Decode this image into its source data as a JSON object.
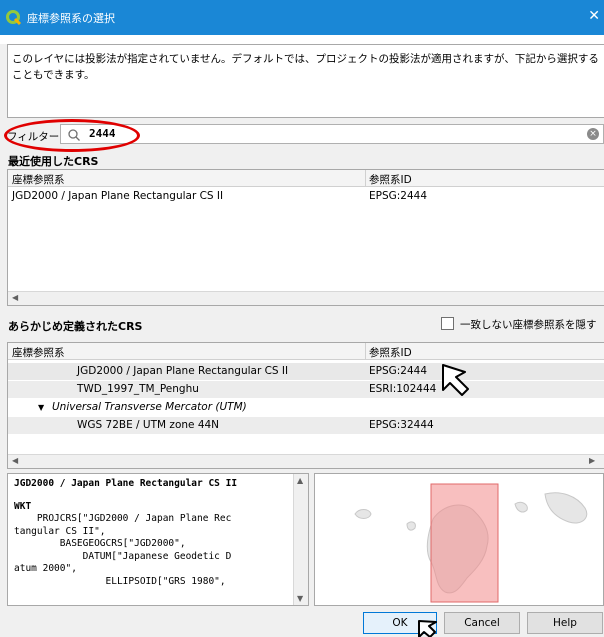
{
  "window": {
    "title": "座標参照系の選択",
    "close_glyph": "✕",
    "accent_color": "#1a87d6"
  },
  "description": "このレイヤには投影法が指定されていません。デフォルトでは、プロジェクトの投影法が適用されますが、下記から選択することもできます。",
  "filter": {
    "label": "フィルター",
    "value": "2444",
    "icon": "search-icon",
    "clear_icon": "clear-icon"
  },
  "recent": {
    "section_title": "最近使用したCRS",
    "columns": [
      "座標参照系",
      "参照系ID"
    ],
    "rows": [
      {
        "crs": "JGD2000 / Japan Plane Rectangular CS II",
        "id": "EPSG:2444"
      }
    ]
  },
  "predefined": {
    "section_title": "あらかじめ定義されたCRS",
    "hide_deprecated_label": "一致しない座標参照系を隠す",
    "hide_deprecated_checked": false,
    "columns": [
      "座標参照系",
      "参照系ID"
    ],
    "rows": [
      {
        "crs": "JGD2000 / Japan Plane Rectangular CS II",
        "id": "EPSG:2444",
        "selected": true
      },
      {
        "crs": "TWD_1997_TM_Penghu",
        "id": "ESRI:102444"
      },
      {
        "crs": "Universal Transverse Mercator (UTM)",
        "id": "",
        "group": true
      },
      {
        "crs": "WGS 72BE / UTM zone 44N",
        "id": "EPSG:32444"
      }
    ]
  },
  "wkt": {
    "name": "JGD2000 / Japan Plane Rectangular CS II",
    "heading": "WKT",
    "lines": [
      "    PROJCRS[\"JGD2000 / Japan Plane Rec",
      "tangular CS II\",",
      "        BASEGEOGCRS[\"JGD2000\",",
      "            DATUM[\"Japanese Geodetic D",
      "atum 2000\",",
      "                ELLIPSOID[\"GRS 1980\","
    ]
  },
  "map": {
    "extent_color": "#f28b8b"
  },
  "buttons": {
    "ok": "OK",
    "cancel": "Cancel",
    "help": "Help"
  }
}
